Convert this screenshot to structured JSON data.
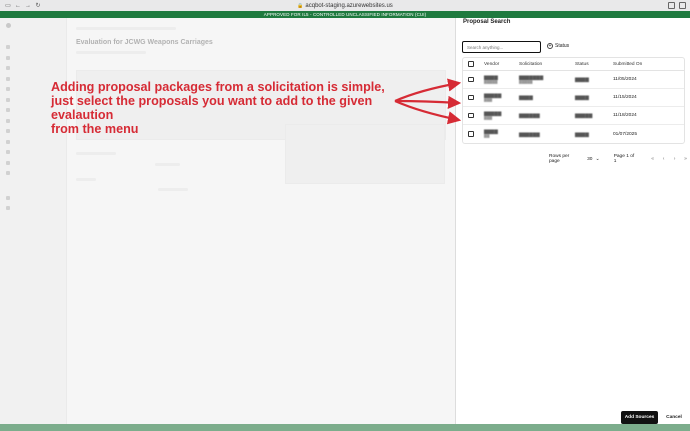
{
  "browser": {
    "url": "acqbot-staging.azurewebsites.us",
    "banner": "APPROVED FOR IL5 - CONTROLLED UNCLASSIFIED INFORMATION (CUI)"
  },
  "background_app": {
    "title": "Evaluation for JCWG Weapons Carriages"
  },
  "drawer": {
    "title": "Proposal Search",
    "search_placeholder": "Search anything...",
    "status_filter_label": "Status",
    "columns": [
      "Vendor",
      "Solicitation",
      "Status",
      "Submitted On"
    ],
    "rows": [
      {
        "submitted_on": "11/05/2024"
      },
      {
        "submitted_on": "11/15/2024"
      },
      {
        "submitted_on": "11/18/2024"
      },
      {
        "submitted_on": "01/07/2025"
      }
    ],
    "pagination": {
      "rows_per_page_label": "Rows per page",
      "rows_per_page_value": "30",
      "page_indicator": "Page 1 of 1"
    },
    "add_sources_label": "Add Sources",
    "cancel_label": "Cancel"
  },
  "annotation": {
    "line1": "Adding proposal packages from a solicitation is simple,",
    "line2": "just select the proposals you want to add to the given evalaution",
    "line3": "from the menu",
    "color": "#d62b35"
  },
  "colors": {
    "banner_green": "#1f7a3f",
    "primary_button": "#111111"
  }
}
